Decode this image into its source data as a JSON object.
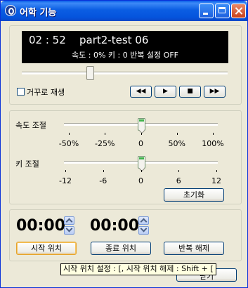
{
  "window": {
    "title": "어학 기능"
  },
  "display": {
    "time": "02 : 52",
    "track": "part2-test 06",
    "status": "속도 : 0%  키 : 0   반복 설정 OFF"
  },
  "playback": {
    "position_fraction": 0.33,
    "reverse_label": "거꾸로 재생",
    "reverse_checked": false,
    "rewind_glyph": "◀◀",
    "play_glyph": "▶",
    "stop_glyph": "■",
    "forward_glyph": "▶▶"
  },
  "speed": {
    "label": "속도 조절",
    "value": 0,
    "ticks": [
      "-50%",
      "-25%",
      "0",
      "50%",
      "100%"
    ]
  },
  "key": {
    "label": "키 조절",
    "value": 0,
    "ticks": [
      "-12",
      "-6",
      "0",
      "6",
      "12"
    ]
  },
  "reset_label": "초기화",
  "ab_repeat": {
    "start_time": "00:00",
    "end_time": "00:00",
    "start_label": "시작 위치",
    "end_label": "종료 위치",
    "clear_label": "반복 해제"
  },
  "tooltip": "시작 위치 설정 : [,  시작 위치 해제 : Shift + [",
  "close_button_partial": "닫기"
}
